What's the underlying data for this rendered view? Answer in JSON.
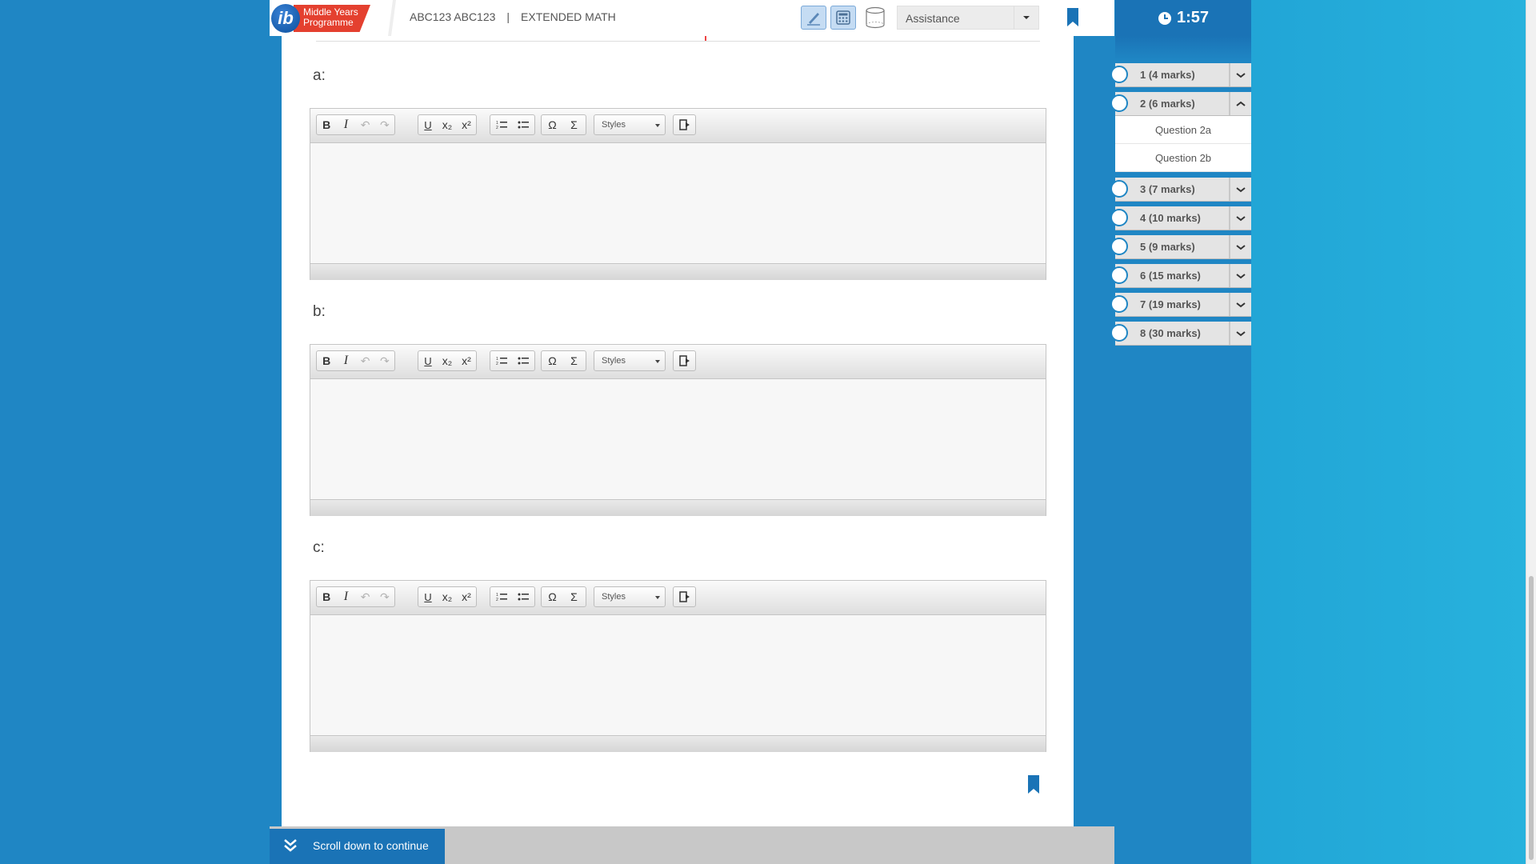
{
  "header": {
    "logo_line1": "Middle Years",
    "logo_line2": "Programme",
    "logo_mark": "ib",
    "candidate": "ABC123 ABC123",
    "separator": "|",
    "subject": "EXTENDED MATH",
    "tools": [
      "pen-icon",
      "calculator-icon",
      "cylinder-icon"
    ],
    "assistance_label": "Assistance"
  },
  "timer": {
    "value": "1:57",
    "icon": "clock-icon"
  },
  "navigation": {
    "items": [
      {
        "label": "1 (4 marks)",
        "expanded": false
      },
      {
        "label": "2 (6 marks)",
        "expanded": true,
        "children": [
          "Question 2a",
          "Question 2b"
        ]
      },
      {
        "label": "3 (7 marks)",
        "expanded": false
      },
      {
        "label": "4 (10 marks)",
        "expanded": false
      },
      {
        "label": "5 (9 marks)",
        "expanded": false
      },
      {
        "label": "6 (15 marks)",
        "expanded": false
      },
      {
        "label": "7 (19 marks)",
        "expanded": false
      },
      {
        "label": "8 (30 marks)",
        "expanded": false
      }
    ]
  },
  "parts": [
    {
      "label": "a:"
    },
    {
      "label": "b:"
    },
    {
      "label": "c:"
    }
  ],
  "editor_toolbar": {
    "bold": "B",
    "italic": "I",
    "underline": "U",
    "subscript": "x₂",
    "superscript": "x²",
    "special_char": "Ω",
    "sum": "Σ",
    "styles_label": "Styles"
  },
  "footer": {
    "scroll_label": "Scroll down to continue"
  },
  "colors": {
    "primary": "#1a73b6",
    "background": "#1f86c4",
    "light": "#27b2dd",
    "logo_red": "#e4402f"
  }
}
